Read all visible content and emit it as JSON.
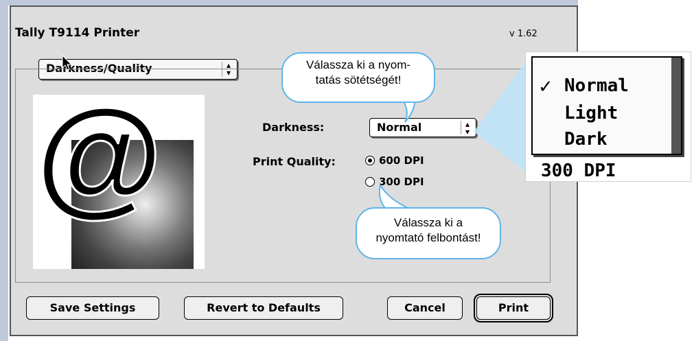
{
  "dialog": {
    "title": "Tally T9114 Printer",
    "version": "v 1.62",
    "panel_popup": "Darkness/Quality"
  },
  "darkness": {
    "label": "Darkness:",
    "value": "Normal"
  },
  "print_quality": {
    "label": "Print Quality:",
    "options": [
      "600 DPI",
      "300 DPI"
    ],
    "selected": "600 DPI"
  },
  "buttons": {
    "save": "Save Settings",
    "revert": "Revert to Defaults",
    "cancel": "Cancel",
    "print": "Print"
  },
  "callouts": {
    "darkness_line1": "Válassza ki a nyom-",
    "darkness_line2": "tatás sötétségét!",
    "resolution_line1": "Válassza ki a",
    "resolution_line2": "nyomtató felbontást!"
  },
  "zoom_menu": {
    "items": [
      "Normal",
      "Light",
      "Dark"
    ],
    "checked": "Normal",
    "partial_row": "300 DPI"
  },
  "graphic": {
    "symbol": "@"
  },
  "colors": {
    "callout_border": "#5fb4e8",
    "side_stripe": "#bfc9da",
    "dialog_bg": "#dddddd"
  }
}
